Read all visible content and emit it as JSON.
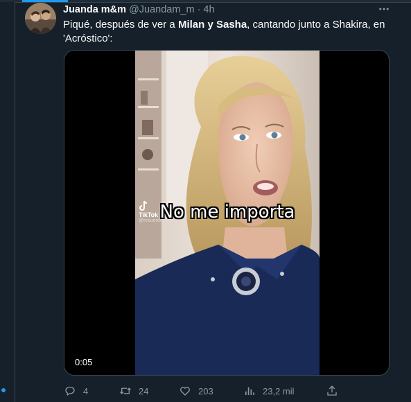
{
  "tweet": {
    "display_name": "Juanda m&m",
    "handle": "@Juandam_m",
    "separator": "·",
    "time": "4h",
    "text_parts": {
      "a": "Piqué, después de ver a ",
      "b": "Milan y Sasha",
      "c": ", cantando junto a Shakira, en 'Acróstico':"
    }
  },
  "video": {
    "caption": "No me importa",
    "tiktok_brand": "TikTok",
    "tiktok_user": "@recuerdos906",
    "timestamp": "0:05"
  },
  "actions": {
    "replies": "4",
    "retweets": "24",
    "likes": "203",
    "views": "23,2 mil"
  },
  "colors": {
    "background": "#15202b",
    "text_primary": "#f7f9f9",
    "text_secondary": "#8b98a5",
    "accent": "#1d9bf0",
    "border": "#38444d"
  },
  "icons": {
    "more": "more-icon",
    "reply": "reply-icon",
    "retweet": "retweet-icon",
    "like": "heart-icon",
    "views": "views-icon",
    "share": "share-icon"
  }
}
